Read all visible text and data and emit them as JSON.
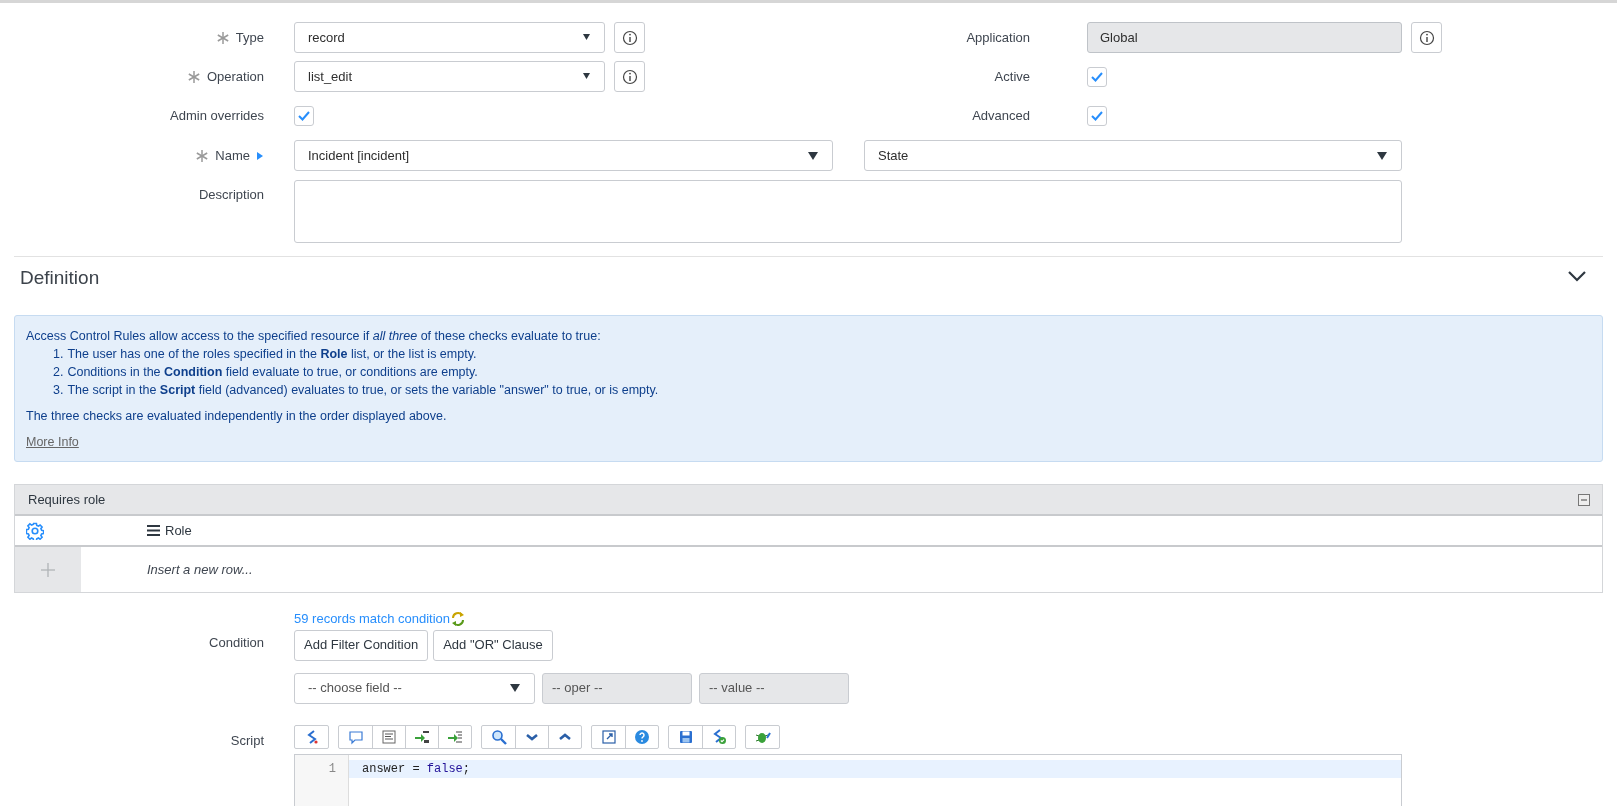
{
  "type": {
    "label": "Type",
    "required": true,
    "value": "record"
  },
  "operation": {
    "label": "Operation",
    "required": true,
    "value": "list_edit"
  },
  "admin_overrides": {
    "label": "Admin overrides",
    "checked": true
  },
  "name": {
    "label": "Name",
    "required": true,
    "value": "Incident [incident]",
    "column": "State"
  },
  "description": {
    "label": "Description"
  },
  "application": {
    "label": "Application",
    "value": "Global",
    "readonly": true
  },
  "active": {
    "label": "Active",
    "checked": true
  },
  "advanced": {
    "label": "Advanced",
    "checked": true
  },
  "section": {
    "title": "Definition",
    "expanded": true
  },
  "info": {
    "intro": "Access Control Rules allow access to the specified resource if *all three* of these checks evaluate to true:",
    "items": [
      {
        "number": "1.",
        "text": "The user has one of the roles specified in the **Role** list, or the list is empty."
      },
      {
        "number": "2.",
        "text": "Conditions in the **Condition** field evaluate to true, or conditions are empty."
      },
      {
        "number": "3.",
        "text": "The script in the **Script** field (advanced) evaluates to true, or sets the variable \"answer\" to true, or is empty."
      }
    ],
    "note": "The three checks are evaluated independently in the order displayed above.",
    "link": "More Info"
  },
  "related_list": {
    "title": "Requires role",
    "columns": [
      "Role"
    ],
    "insert_row": "Insert a new row..."
  },
  "condition": {
    "label": "Condition",
    "match_link": "59 records match condition",
    "buttons": [
      "Add Filter Condition",
      "Add \"OR\" Clause"
    ],
    "field": "-- choose field --",
    "operator": {
      "text": "-- oper --",
      "disabled": true
    },
    "value": {
      "text": "-- value --",
      "disabled": true
    }
  },
  "script": {
    "label": "Script",
    "toolbar": [
      [
        {
          "kind": "toggle"
        }
      ],
      [
        {
          "kind": "comment"
        },
        {
          "kind": "format"
        },
        {
          "kind": "replace"
        },
        {
          "kind": "replace-all"
        }
      ],
      [
        {
          "kind": "search"
        },
        {
          "kind": "next"
        },
        {
          "kind": "previous"
        }
      ],
      [
        {
          "kind": "fullscreen"
        },
        {
          "kind": "help"
        }
      ],
      [
        {
          "kind": "save"
        },
        {
          "kind": "check"
        }
      ],
      [
        {
          "kind": "debug"
        }
      ]
    ],
    "lines": [
      {
        "number": "1",
        "active": true,
        "tokens": [
          {
            "kind": "plain",
            "text": "answer = "
          },
          {
            "kind": "keyword",
            "text": "false"
          },
          {
            "kind": "plain",
            "text": ";"
          }
        ]
      }
    ]
  }
}
